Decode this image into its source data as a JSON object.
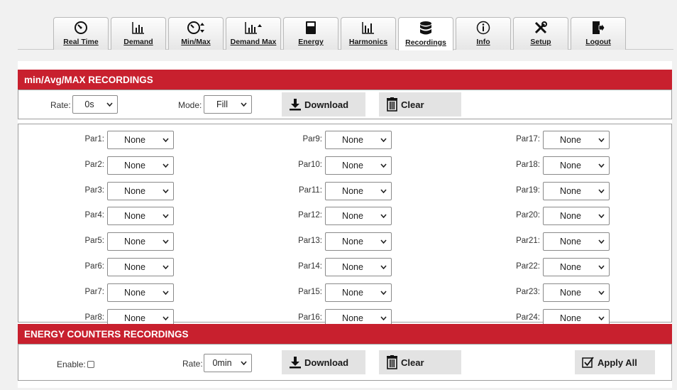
{
  "tabs": [
    {
      "label": "Real Time",
      "icon": "gauge-icon"
    },
    {
      "label": "Demand",
      "icon": "bar-chart-icon"
    },
    {
      "label": "Min/Max",
      "icon": "gauge-updown-icon"
    },
    {
      "label": "Demand Max",
      "icon": "bar-chart-max-icon"
    },
    {
      "label": "Energy",
      "icon": "meter-icon"
    },
    {
      "label": "Harmonics",
      "icon": "harmonics-icon"
    },
    {
      "label": "Recordings",
      "icon": "database-icon",
      "active": true
    },
    {
      "label": "Info",
      "icon": "info-icon"
    },
    {
      "label": "Setup",
      "icon": "tools-icon"
    },
    {
      "label": "Logout",
      "icon": "logout-icon"
    }
  ],
  "minmax": {
    "title": "min/Avg/MAX RECORDINGS",
    "rate_label": "Rate:",
    "rate_value": "0s",
    "mode_label": "Mode:",
    "mode_value": "Fill",
    "download_label": "Download",
    "clear_label": "Clear",
    "params": [
      {
        "label": "Par1:",
        "value": "None"
      },
      {
        "label": "Par2:",
        "value": "None"
      },
      {
        "label": "Par3:",
        "value": "None"
      },
      {
        "label": "Par4:",
        "value": "None"
      },
      {
        "label": "Par5:",
        "value": "None"
      },
      {
        "label": "Par6:",
        "value": "None"
      },
      {
        "label": "Par7:",
        "value": "None"
      },
      {
        "label": "Par8:",
        "value": "None"
      },
      {
        "label": "Par9:",
        "value": "None"
      },
      {
        "label": "Par10:",
        "value": "None"
      },
      {
        "label": "Par11:",
        "value": "None"
      },
      {
        "label": "Par12:",
        "value": "None"
      },
      {
        "label": "Par13:",
        "value": "None"
      },
      {
        "label": "Par14:",
        "value": "None"
      },
      {
        "label": "Par15:",
        "value": "None"
      },
      {
        "label": "Par16:",
        "value": "None"
      },
      {
        "label": "Par17:",
        "value": "None"
      },
      {
        "label": "Par18:",
        "value": "None"
      },
      {
        "label": "Par19:",
        "value": "None"
      },
      {
        "label": "Par20:",
        "value": "None"
      },
      {
        "label": "Par21:",
        "value": "None"
      },
      {
        "label": "Par22:",
        "value": "None"
      },
      {
        "label": "Par23:",
        "value": "None"
      },
      {
        "label": "Par24:",
        "value": "None"
      }
    ]
  },
  "energy": {
    "title": "ENERGY COUNTERS RECORDINGS",
    "enable_label": "Enable:",
    "enable_checked": false,
    "rate_label": "Rate:",
    "rate_value": "0min",
    "download_label": "Download",
    "clear_label": "Clear",
    "apply_all_label": "Apply All"
  },
  "colors": {
    "header_red": "#c8202e",
    "button_gray": "#e3e3e3"
  }
}
